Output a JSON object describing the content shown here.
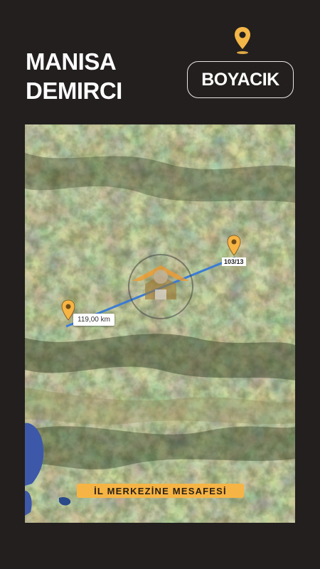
{
  "header": {
    "title_line1": "MANISA",
    "title_line2": "DEMIRCI",
    "badge_label": "BOYACIK",
    "pin_icon": "location-pin-icon"
  },
  "map": {
    "distance_label": "119,00 km",
    "parcel_label": "103/13",
    "caption": "İL MERKEZİNE MESAFESİ",
    "route_color": "#3a7bd5",
    "pin_color": "#f6b445"
  },
  "colors": {
    "background": "#231f1e",
    "accent": "#f6b445",
    "text": "#ffffff"
  }
}
